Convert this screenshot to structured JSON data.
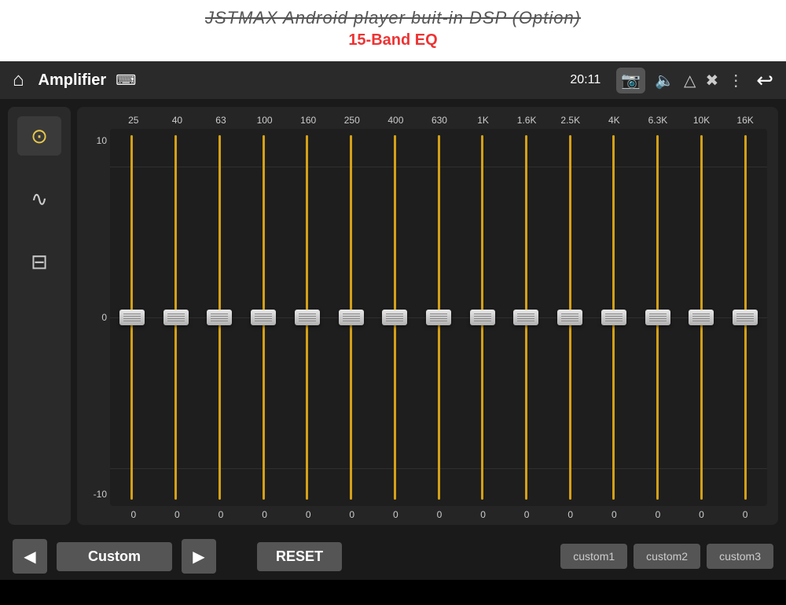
{
  "header": {
    "title": "JSTMAX  Android player buit-in DSP (Option)",
    "subtitle": "15-Band EQ"
  },
  "statusBar": {
    "appTitle": "Amplifier",
    "time": "20:11",
    "usbIcon": "⌨",
    "icons": [
      "📷",
      "🔈",
      "△",
      "✖",
      "⋮"
    ],
    "backIcon": "↩"
  },
  "sidebar": {
    "buttons": [
      {
        "id": "eq-icon",
        "icon": "⚙",
        "active": true
      },
      {
        "id": "wave-icon",
        "icon": "〜",
        "active": false
      },
      {
        "id": "speaker-icon",
        "icon": "⊟",
        "active": false
      }
    ]
  },
  "eq": {
    "frequencies": [
      "25",
      "40",
      "63",
      "100",
      "160",
      "250",
      "400",
      "630",
      "1K",
      "1.6K",
      "2.5K",
      "4K",
      "6.3K",
      "10K",
      "16K"
    ],
    "dbLabels": [
      "10",
      "0",
      "-10"
    ],
    "values": [
      0,
      0,
      0,
      0,
      0,
      0,
      0,
      0,
      0,
      0,
      0,
      0,
      0,
      0,
      0
    ],
    "thumbPositions": [
      50,
      50,
      50,
      50,
      50,
      50,
      50,
      50,
      50,
      50,
      50,
      50,
      50,
      50,
      50
    ]
  },
  "bottomBar": {
    "prevLabel": "◀",
    "nextLabel": "▶",
    "presetLabel": "Custom",
    "resetLabel": "RESET",
    "customButtons": [
      "custom1",
      "custom2",
      "custom3"
    ]
  }
}
